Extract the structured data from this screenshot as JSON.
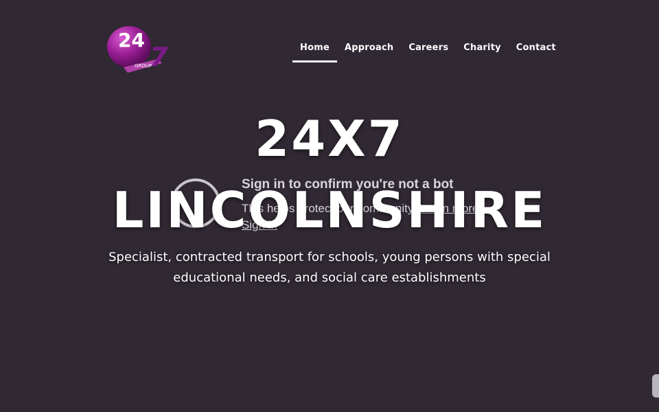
{
  "logo": {
    "number": "24",
    "seven": "7",
    "group": "GROUP"
  },
  "nav": [
    {
      "label": "Home",
      "active": true
    },
    {
      "label": "Approach"
    },
    {
      "label": "Careers"
    },
    {
      "label": "Charity"
    },
    {
      "label": "Contact"
    }
  ],
  "signin_overlay": {
    "title": "Sign in to confirm you're not a bot",
    "text": "This helps protect our community.",
    "learn_more": "Learn more",
    "link": "Sign in"
  },
  "hero": {
    "title_line1": "24X7",
    "title_line2": "LINCOLNSHIRE",
    "subtitle": "Specialist, contracted transport for schools, young persons with special educational needs, and social care establishments"
  },
  "colors": {
    "background": "#302833",
    "brand_purple": "#8a1f8a",
    "text": "#ffffff"
  }
}
